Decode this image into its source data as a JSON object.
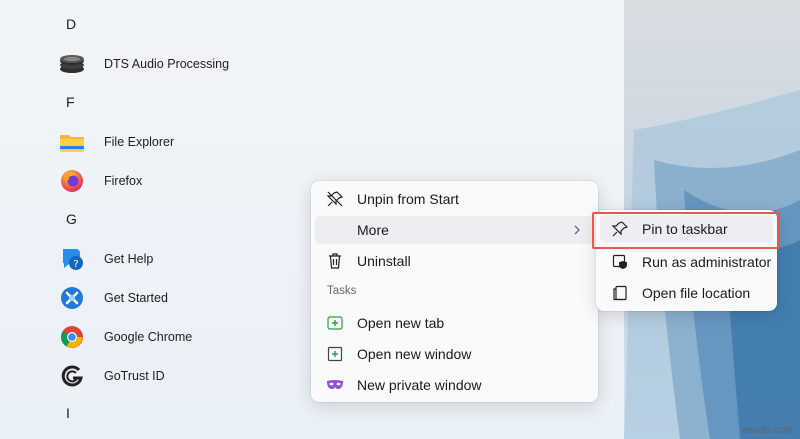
{
  "start_menu": {
    "letters": [
      "D",
      "F",
      "G",
      "I"
    ],
    "apps": [
      {
        "label": "DTS Audio Processing",
        "icon": "dts-audio-icon"
      },
      {
        "label": "File Explorer",
        "icon": "file-explorer-icon"
      },
      {
        "label": "Firefox",
        "icon": "firefox-icon"
      },
      {
        "label": "Get Help",
        "icon": "get-help-icon"
      },
      {
        "label": "Get Started",
        "icon": "get-started-icon"
      },
      {
        "label": "Google Chrome",
        "icon": "chrome-icon"
      },
      {
        "label": "GoTrust ID",
        "icon": "gotrust-icon"
      }
    ]
  },
  "context_menu": {
    "unpin": "Unpin from Start",
    "more": "More",
    "uninstall": "Uninstall",
    "tasks_header": "Tasks",
    "open_new_tab": "Open new tab",
    "open_new_window": "Open new window",
    "new_private_window": "New private window"
  },
  "submenu": {
    "pin_to_taskbar": "Pin to taskbar",
    "run_as_admin": "Run as administrator",
    "open_file_location": "Open file location"
  },
  "watermark": "wsxdn.com",
  "colors": {
    "highlight": "#e55a4e",
    "firefox_orange": "#ff7139",
    "chrome_red": "#db4437"
  }
}
